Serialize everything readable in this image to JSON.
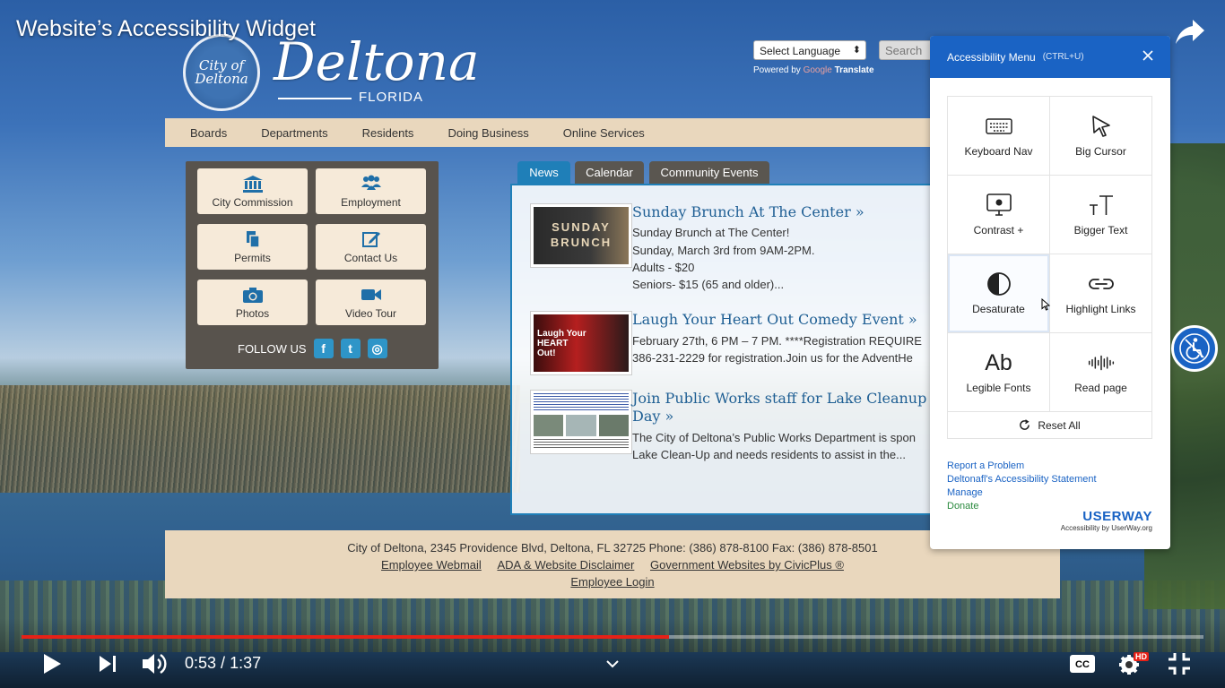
{
  "video": {
    "title": "Website’s Accessibility Widget",
    "time_current": "0:53",
    "time_separator": " / ",
    "time_total": "1:37",
    "progress": 0.548,
    "hd_badge": "HD",
    "accent": "#e62117"
  },
  "site": {
    "seal_text": "City of Deltona",
    "logo_name": "Deltona",
    "logo_state": "FLORIDA",
    "language_select": "Select Language",
    "search_placeholder": "Search",
    "powered_prefix": "Powered by",
    "powered_brand": "Google",
    "powered_suffix": "Translate",
    "nav": [
      "Boards",
      "Departments",
      "Residents",
      "Doing Business",
      "Online Services"
    ],
    "quick_links": [
      {
        "label": "City Commission",
        "icon": "building-icon"
      },
      {
        "label": "Employment",
        "icon": "people-icon"
      },
      {
        "label": "Permits",
        "icon": "documents-icon"
      },
      {
        "label": "Contact Us",
        "icon": "edit-icon"
      },
      {
        "label": "Photos",
        "icon": "camera-icon"
      },
      {
        "label": "Video Tour",
        "icon": "video-camera-icon"
      }
    ],
    "follow_us": "FOLLOW US",
    "tabs": [
      "News",
      "Calendar",
      "Community Events"
    ],
    "news": [
      {
        "title": "Sunday Brunch At The Center  »",
        "thumb_text": "SUNDAY BRUNCH",
        "lines": [
          "Sunday Brunch at The Center!",
          "Sunday, March 3rd from 9AM-2PM.",
          "Adults - $20",
          "Seniors- $15 (65 and older)..."
        ]
      },
      {
        "title": "Laugh Your Heart Out Comedy Event »",
        "thumb_text": "Laugh Your HEART Out!",
        "lines": [
          "February 27th, 6 PM – 7 PM. ****Registration REQUIRE",
          "386-231-2229 for registration.Join us for the AdventHe"
        ]
      },
      {
        "title_line1": "Join Public Works staff for Lake Cleanup &",
        "title_line2": "Day »",
        "lines": [
          "The City of Deltona’s Public Works Department is spon",
          "Lake Clean-Up and needs residents to assist in the..."
        ]
      }
    ],
    "footer": {
      "address": "City of Deltona, 2345 Providence Blvd, Deltona, FL 32725  Phone: (386) 878-8100 Fax: (386) 878-8501",
      "links": [
        "Employee Webmail",
        "ADA & Website Disclaimer",
        "Government Websites by CivicPlus ®"
      ],
      "login": "Employee Login"
    }
  },
  "widget": {
    "title": "Accessibility Menu",
    "shortcut": "(CTRL+U)",
    "accent": "#1a63c4",
    "tiles": [
      {
        "label": "Keyboard Nav",
        "icon": "keyboard-icon"
      },
      {
        "label": "Big Cursor",
        "icon": "cursor-icon"
      },
      {
        "label": "Contrast +",
        "icon": "monitor-icon"
      },
      {
        "label": "Bigger Text",
        "icon": "text-size-icon"
      },
      {
        "label": "Desaturate",
        "icon": "half-circle-icon"
      },
      {
        "label": "Highlight Links",
        "icon": "link-icon"
      },
      {
        "label": "Legible Fonts",
        "icon": "font-icon",
        "glyph": "Ab"
      },
      {
        "label": "Read page",
        "icon": "sound-wave-icon"
      }
    ],
    "reset_label": "Reset All",
    "links": [
      "Report a Problem",
      "Deltonafl's Accessibility Statement",
      "Manage",
      "Donate"
    ],
    "brand": "USERWAY",
    "brand_sub": "Accessibility by UserWay.org"
  }
}
